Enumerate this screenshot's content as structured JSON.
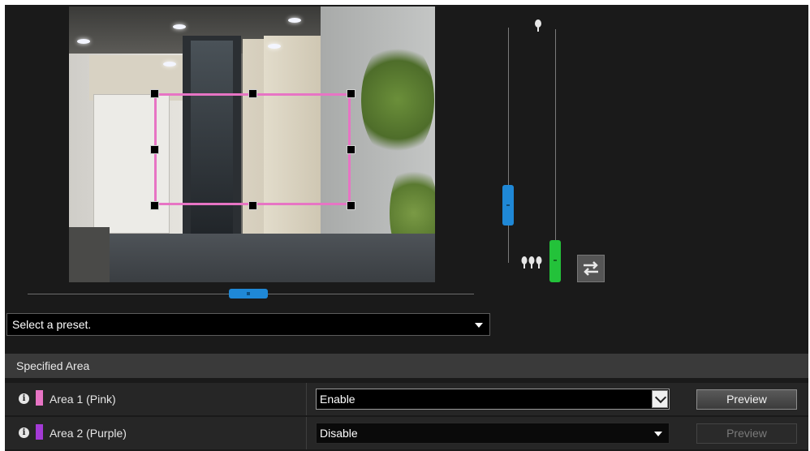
{
  "preset": {
    "placeholder": "Select a preset."
  },
  "section": {
    "title": "Specified Area"
  },
  "areas": [
    {
      "label": "Area 1 (Pink)",
      "color": "#e774c4",
      "status": "Enable",
      "preview_label": "Preview",
      "preview_enabled": true
    },
    {
      "label": "Area 2 (Purple)",
      "color": "#a43ad6",
      "status": "Disable",
      "preview_label": "Preview",
      "preview_enabled": false
    }
  ],
  "icons": {
    "sensitivity_high": "single-tree-icon",
    "sensitivity_low": "three-trees-icon",
    "swap": "swap-arrows-icon",
    "info": "info-icon"
  },
  "colors": {
    "area_outline": "#e774c4",
    "slider_blue": "#1f88d6",
    "slider_green": "#23c23a"
  }
}
